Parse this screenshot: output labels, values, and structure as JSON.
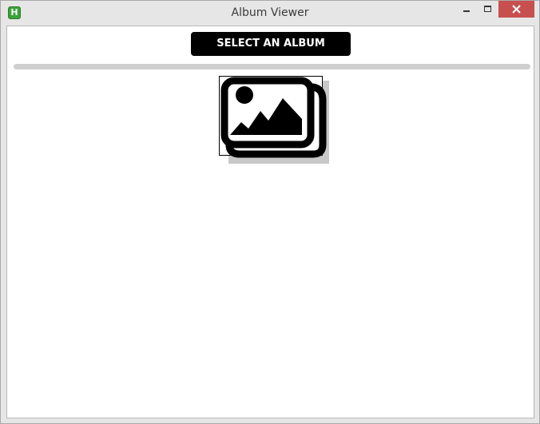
{
  "window": {
    "title": "Album Viewer",
    "app_icon_letter": "H",
    "controls": {
      "minimize_icon": "minimize-icon",
      "maximize_icon": "maximize-icon",
      "close_icon": "close-icon"
    },
    "close_color": "#c7504f",
    "app_icon_color": "#3aa33a"
  },
  "toolbar": {
    "select_album_label": "SELECT AN ALBUM"
  },
  "content": {
    "placeholder_icon": "image-gallery-icon"
  }
}
